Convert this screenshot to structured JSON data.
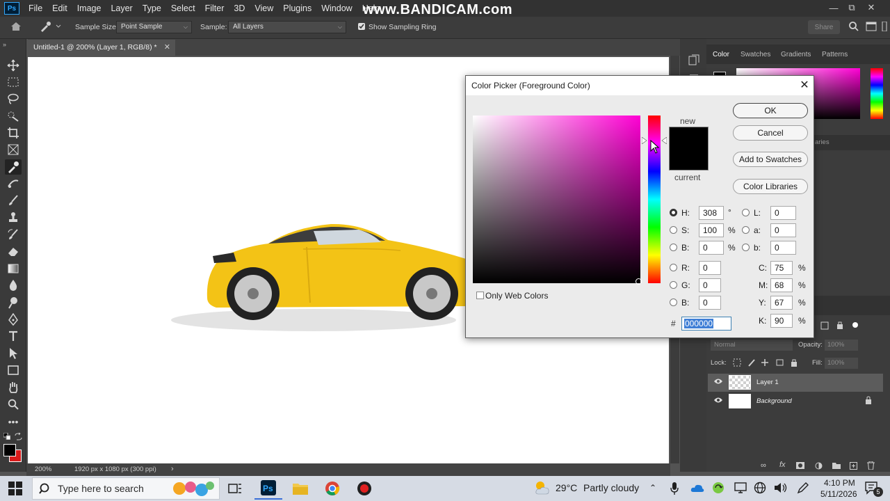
{
  "watermark": "www.BANDICAM.com",
  "menu": [
    "File",
    "Edit",
    "Image",
    "Layer",
    "Type",
    "Select",
    "Filter",
    "3D",
    "View",
    "Plugins",
    "Window",
    "Help"
  ],
  "options_bar": {
    "sample_size_label": "Sample Size:",
    "sample_size_value": "Point Sample",
    "sample_label": "Sample:",
    "sample_value": "All Layers",
    "show_ring_label": "Show Sampling Ring",
    "show_ring_checked": true,
    "share_label": "Share"
  },
  "document": {
    "tab_title": "Untitled-1 @ 200% (Layer 1, RGB/8) *",
    "zoom": "200%",
    "dimensions": "1920 px x 1080 px (300 ppi)"
  },
  "panels": {
    "tabs": [
      "Color",
      "Swatches",
      "Gradients",
      "Patterns"
    ],
    "libraries_partial": "aries",
    "blend_mode": "Normal",
    "opacity_label": "Opacity:",
    "opacity_value": "100%",
    "lock_label": "Lock:",
    "fill_label": "Fill:",
    "fill_value": "100%",
    "layers": [
      {
        "name": "Layer 1",
        "visible": true,
        "selected": true
      },
      {
        "name": "Background",
        "visible": true,
        "locked": true
      }
    ]
  },
  "color_picker": {
    "title": "Color Picker (Foreground Color)",
    "new_label": "new",
    "current_label": "current",
    "buttons": {
      "ok": "OK",
      "cancel": "Cancel",
      "add_to_swatches": "Add to Swatches",
      "color_libraries": "Color Libraries"
    },
    "only_web_colors": "Only Web Colors",
    "hsb": [
      {
        "label": "H:",
        "value": "308",
        "unit": "°",
        "checked": true
      },
      {
        "label": "S:",
        "value": "100",
        "unit": "%",
        "checked": false
      },
      {
        "label": "B:",
        "value": "0",
        "unit": "%",
        "checked": false
      }
    ],
    "rgb": [
      {
        "label": "R:",
        "value": "0"
      },
      {
        "label": "G:",
        "value": "0"
      },
      {
        "label": "B:",
        "value": "0"
      }
    ],
    "lab": [
      {
        "label": "L:",
        "value": "0"
      },
      {
        "label": "a:",
        "value": "0"
      },
      {
        "label": "b:",
        "value": "0"
      }
    ],
    "cmyk": [
      {
        "label": "C:",
        "value": "75",
        "unit": "%"
      },
      {
        "label": "M:",
        "value": "68",
        "unit": "%"
      },
      {
        "label": "Y:",
        "value": "67",
        "unit": "%"
      },
      {
        "label": "K:",
        "value": "90",
        "unit": "%"
      }
    ],
    "hex_label": "#",
    "hex_value": "000000",
    "hue_color": "#ff00d4",
    "new_color": "#000000"
  },
  "taskbar": {
    "search_placeholder": "Type here to search",
    "weather_temp": "29°C",
    "weather_text": "Partly cloudy",
    "time": "4:10 PM",
    "date": "5/11/2026",
    "notification_count": "5"
  }
}
